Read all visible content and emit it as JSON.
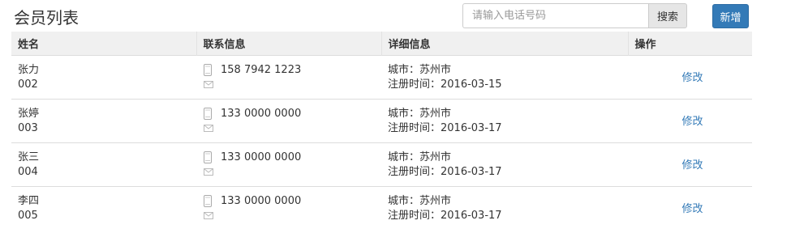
{
  "header": {
    "title": "会员列表",
    "search_placeholder": "请输入电话号码",
    "search_label": "搜索",
    "new_label": "新增"
  },
  "table": {
    "columns": [
      "姓名",
      "联系信息",
      "详细信息",
      "操作"
    ],
    "rows": [
      {
        "name": "张力",
        "id": "002",
        "phone": "158 7942 1223",
        "city": "城市：苏州市",
        "registered": "注册时间：2016-03-15",
        "action": "修改"
      },
      {
        "name": "张婷",
        "id": "003",
        "phone": "133 0000 0000",
        "city": "城市：苏州市",
        "registered": "注册时间：2016-03-17",
        "action": "修改"
      },
      {
        "name": "张三",
        "id": "004",
        "phone": "133 0000 0000",
        "city": "城市：苏州市",
        "registered": "注册时间：2016-03-17",
        "action": "修改"
      },
      {
        "name": "李四",
        "id": "005",
        "phone": "133 0000 0000",
        "city": "城市：苏州市",
        "registered": "注册时间：2016-03-17",
        "action": "修改"
      }
    ]
  },
  "icons": {
    "phone": "mobile-phone-icon",
    "mail": "envelope-icon"
  },
  "colors": {
    "primary": "#337ab7",
    "header_bg": "#f0f0f0"
  }
}
